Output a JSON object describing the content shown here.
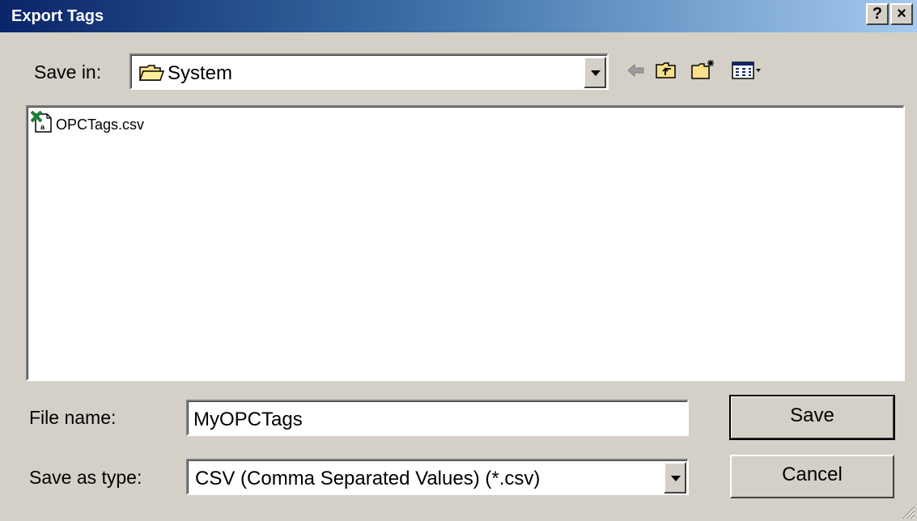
{
  "window": {
    "title": "Export Tags",
    "help_label": "?",
    "close_label": "×"
  },
  "save_in": {
    "label": "Save in:",
    "value": "System"
  },
  "toolbar": {
    "icons": [
      "back-arrow-icon",
      "up-folder-icon",
      "new-folder-icon",
      "view-menu-icon"
    ]
  },
  "files": [
    {
      "name": "OPCTags.csv",
      "icon": "excel-csv-icon"
    }
  ],
  "file_name": {
    "label": "File name:",
    "value": "MyOPCTags"
  },
  "save_as_type": {
    "label": "Save as type:",
    "value": "CSV (Comma Separated Values) (*.csv)"
  },
  "buttons": {
    "save": "Save",
    "cancel": "Cancel"
  },
  "colors": {
    "title_start": "#0a246a",
    "title_end": "#a6caf0",
    "face": "#d4d0c8"
  }
}
